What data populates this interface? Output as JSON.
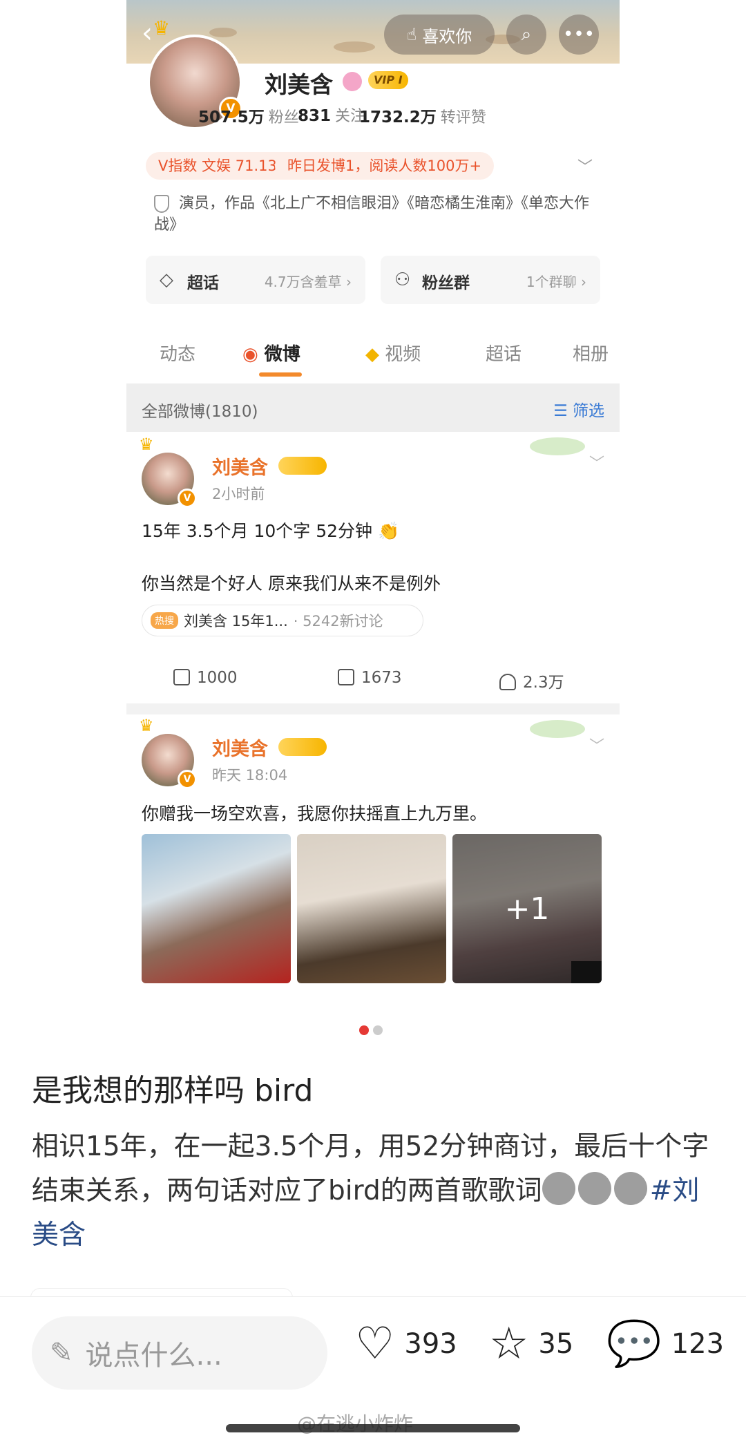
{
  "profile": {
    "like_label": "喜欢你",
    "name": "刘美含",
    "vip_badge": "VIP I",
    "stats": [
      {
        "value": "507.5万",
        "label": "粉丝"
      },
      {
        "value": "831",
        "label": "关注"
      },
      {
        "value": "1732.2万",
        "label": "转评赞"
      }
    ],
    "pills": [
      "V指数 文娱 71.13分",
      "昨日发博1，阅读人数100万+"
    ],
    "bio": "演员，作品《北上广不相信眼泪》《暗恋橘生淮南》《单恋大作战》",
    "cards": [
      {
        "label": "超话",
        "sub": "4.7万含羞草",
        "icon": "diamond-icon"
      },
      {
        "label": "粉丝群",
        "sub": "1个群聊",
        "icon": "group-icon"
      }
    ],
    "tabs": [
      "动态",
      "微博",
      "视频",
      "超话",
      "相册"
    ],
    "filter_count": "全部微博(1810)",
    "filter_label": "筛选"
  },
  "posts": [
    {
      "name": "刘美含",
      "time": "2小时前",
      "line1": "15年 3.5个月 10个字 52分钟 👏",
      "line2": "你当然是个好人   原来我们从来不是例外",
      "topic_tag": "热搜",
      "topic_text": "刘美含 15年1...",
      "topic_meta": "· 5242新讨论",
      "reposts": "1000",
      "comments": "1673",
      "likes": "2.3万"
    },
    {
      "name": "刘美含",
      "time": "昨天 18:04",
      "text": "你赠我一场空欢喜，我愿你扶摇直上九万里。",
      "more_photos": "+1"
    }
  ],
  "note": {
    "title": "是我想的那样吗 bird",
    "body": "相识15年，在一起3.5个月，用52分钟商讨，最后十个字结束关系，两句话对应了bird的两首歌歌词",
    "hashtag": "#刘美含"
  },
  "bottom_bar": {
    "comment_placeholder": "说点什么...",
    "likes": "393",
    "stars": "35",
    "comments": "123",
    "watermark": "@在逃小炸炸"
  },
  "colors": {
    "accent_orange": "#f38a2c",
    "pill_text": "#e9522b",
    "link_blue": "#2a4c86",
    "active_dot": "#e53935"
  }
}
